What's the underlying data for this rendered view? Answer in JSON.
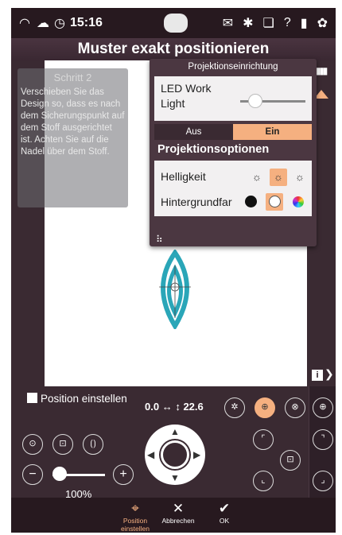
{
  "status": {
    "time": "15:16"
  },
  "title": "Muster exakt positionieren",
  "hint": {
    "step": "Schritt 2",
    "text": "Verschieben Sie das Design so, dass es nach dem Sicherungspunkt auf dem Stoff ausgerichtet ist. Achten Sie auf die Nadel über dem Stoff."
  },
  "projection": {
    "header": "Projektionseinrichtung",
    "led_label": "LED Work Light",
    "off_label": "Aus",
    "on_label": "Ein",
    "options_heading": "Projektionsoptionen",
    "brightness_label": "Helligkeit",
    "background_label": "Hintergrundfar"
  },
  "controls": {
    "position_label": "Position einstellen",
    "x_value": "0.0",
    "y_value": "22.6",
    "zoom": "100%"
  },
  "toolbar": {
    "position": "Position einstellen",
    "cancel": "Abbrechen",
    "ok": "OK"
  },
  "colors": {
    "accent": "#f5b080",
    "design": "#2aa6b8"
  }
}
